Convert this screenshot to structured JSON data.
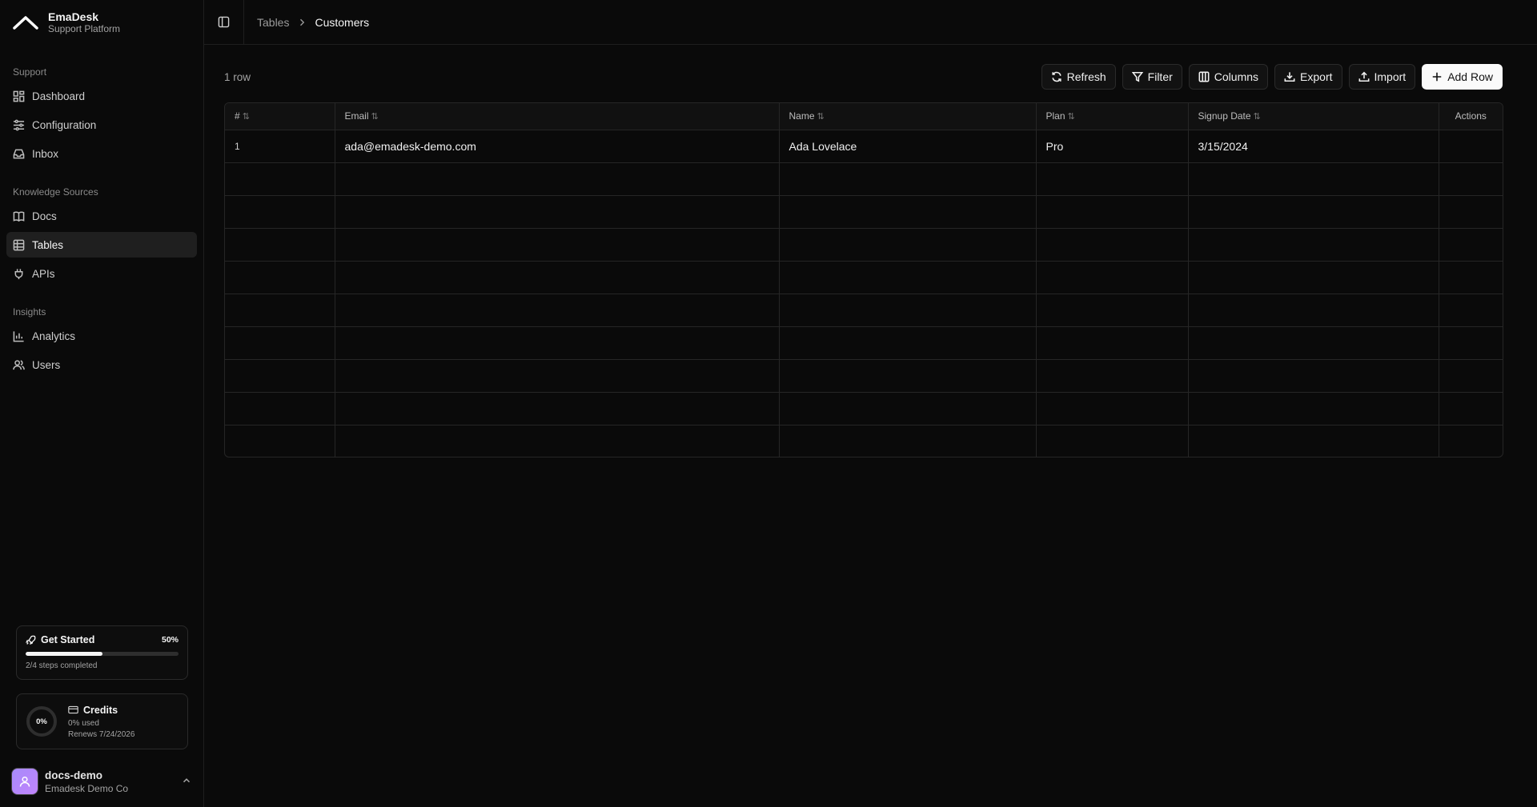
{
  "brand": {
    "name": "EmaDesk",
    "subtitle": "Support Platform"
  },
  "sidebar": {
    "sections": [
      {
        "label": "Support",
        "items": [
          {
            "label": "Dashboard",
            "icon": "dashboard-icon"
          },
          {
            "label": "Configuration",
            "icon": "sliders-icon"
          },
          {
            "label": "Inbox",
            "icon": "inbox-icon"
          }
        ]
      },
      {
        "label": "Knowledge Sources",
        "items": [
          {
            "label": "Docs",
            "icon": "book-icon"
          },
          {
            "label": "Tables",
            "icon": "table-icon",
            "active": true
          },
          {
            "label": "APIs",
            "icon": "plug-icon"
          }
        ]
      },
      {
        "label": "Insights",
        "items": [
          {
            "label": "Analytics",
            "icon": "bar-chart-icon"
          },
          {
            "label": "Users",
            "icon": "users-icon"
          }
        ]
      }
    ],
    "get_started": {
      "title": "Get Started",
      "percent_label": "50%",
      "progress": 0.5,
      "steps": "2/4 steps completed"
    },
    "credits": {
      "title": "Credits",
      "ring_label": "0%",
      "used": "0% used",
      "renews": "Renews 7/24/2026"
    },
    "user": {
      "name": "docs-demo",
      "org": "Emadesk Demo Co"
    }
  },
  "topbar": {
    "breadcrumb_parent": "Tables",
    "breadcrumb_current": "Customers"
  },
  "toolbar": {
    "row_count": "1 row",
    "refresh": "Refresh",
    "filter": "Filter",
    "columns": "Columns",
    "export": "Export",
    "import": "Import",
    "add_row": "Add Row"
  },
  "table": {
    "columns": [
      "#",
      "Email",
      "Name",
      "Plan",
      "Signup Date",
      "Actions"
    ],
    "rows": [
      [
        "1",
        "ada@emadesk-demo.com",
        "Ada Lovelace",
        "Pro",
        "3/15/2024",
        ""
      ]
    ],
    "empty_rows": 9
  },
  "colors": {
    "background": "#0a0a0a",
    "border": "#262626",
    "primary_button": "#fafafa"
  }
}
